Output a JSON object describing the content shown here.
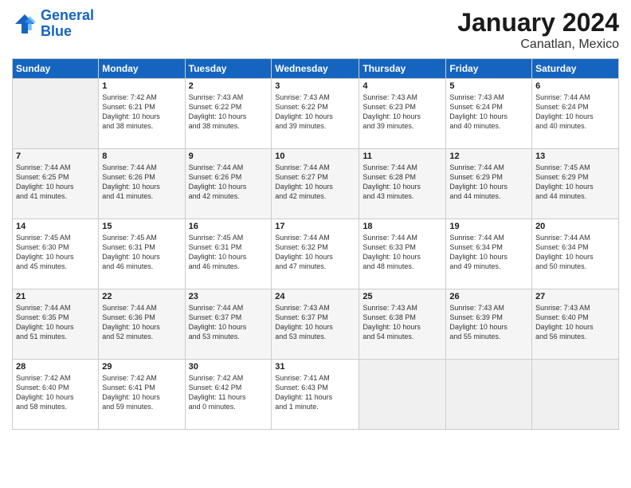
{
  "header": {
    "logo_line1": "General",
    "logo_line2": "Blue",
    "title": "January 2024",
    "subtitle": "Canatlan, Mexico"
  },
  "days_of_week": [
    "Sunday",
    "Monday",
    "Tuesday",
    "Wednesday",
    "Thursday",
    "Friday",
    "Saturday"
  ],
  "weeks": [
    [
      {
        "day": "",
        "info": ""
      },
      {
        "day": "1",
        "info": "Sunrise: 7:42 AM\nSunset: 6:21 PM\nDaylight: 10 hours\nand 38 minutes."
      },
      {
        "day": "2",
        "info": "Sunrise: 7:43 AM\nSunset: 6:22 PM\nDaylight: 10 hours\nand 38 minutes."
      },
      {
        "day": "3",
        "info": "Sunrise: 7:43 AM\nSunset: 6:22 PM\nDaylight: 10 hours\nand 39 minutes."
      },
      {
        "day": "4",
        "info": "Sunrise: 7:43 AM\nSunset: 6:23 PM\nDaylight: 10 hours\nand 39 minutes."
      },
      {
        "day": "5",
        "info": "Sunrise: 7:43 AM\nSunset: 6:24 PM\nDaylight: 10 hours\nand 40 minutes."
      },
      {
        "day": "6",
        "info": "Sunrise: 7:44 AM\nSunset: 6:24 PM\nDaylight: 10 hours\nand 40 minutes."
      }
    ],
    [
      {
        "day": "7",
        "info": "Sunrise: 7:44 AM\nSunset: 6:25 PM\nDaylight: 10 hours\nand 41 minutes."
      },
      {
        "day": "8",
        "info": "Sunrise: 7:44 AM\nSunset: 6:26 PM\nDaylight: 10 hours\nand 41 minutes."
      },
      {
        "day": "9",
        "info": "Sunrise: 7:44 AM\nSunset: 6:26 PM\nDaylight: 10 hours\nand 42 minutes."
      },
      {
        "day": "10",
        "info": "Sunrise: 7:44 AM\nSunset: 6:27 PM\nDaylight: 10 hours\nand 42 minutes."
      },
      {
        "day": "11",
        "info": "Sunrise: 7:44 AM\nSunset: 6:28 PM\nDaylight: 10 hours\nand 43 minutes."
      },
      {
        "day": "12",
        "info": "Sunrise: 7:44 AM\nSunset: 6:29 PM\nDaylight: 10 hours\nand 44 minutes."
      },
      {
        "day": "13",
        "info": "Sunrise: 7:45 AM\nSunset: 6:29 PM\nDaylight: 10 hours\nand 44 minutes."
      }
    ],
    [
      {
        "day": "14",
        "info": "Sunrise: 7:45 AM\nSunset: 6:30 PM\nDaylight: 10 hours\nand 45 minutes."
      },
      {
        "day": "15",
        "info": "Sunrise: 7:45 AM\nSunset: 6:31 PM\nDaylight: 10 hours\nand 46 minutes."
      },
      {
        "day": "16",
        "info": "Sunrise: 7:45 AM\nSunset: 6:31 PM\nDaylight: 10 hours\nand 46 minutes."
      },
      {
        "day": "17",
        "info": "Sunrise: 7:44 AM\nSunset: 6:32 PM\nDaylight: 10 hours\nand 47 minutes."
      },
      {
        "day": "18",
        "info": "Sunrise: 7:44 AM\nSunset: 6:33 PM\nDaylight: 10 hours\nand 48 minutes."
      },
      {
        "day": "19",
        "info": "Sunrise: 7:44 AM\nSunset: 6:34 PM\nDaylight: 10 hours\nand 49 minutes."
      },
      {
        "day": "20",
        "info": "Sunrise: 7:44 AM\nSunset: 6:34 PM\nDaylight: 10 hours\nand 50 minutes."
      }
    ],
    [
      {
        "day": "21",
        "info": "Sunrise: 7:44 AM\nSunset: 6:35 PM\nDaylight: 10 hours\nand 51 minutes."
      },
      {
        "day": "22",
        "info": "Sunrise: 7:44 AM\nSunset: 6:36 PM\nDaylight: 10 hours\nand 52 minutes."
      },
      {
        "day": "23",
        "info": "Sunrise: 7:44 AM\nSunset: 6:37 PM\nDaylight: 10 hours\nand 53 minutes."
      },
      {
        "day": "24",
        "info": "Sunrise: 7:43 AM\nSunset: 6:37 PM\nDaylight: 10 hours\nand 53 minutes."
      },
      {
        "day": "25",
        "info": "Sunrise: 7:43 AM\nSunset: 6:38 PM\nDaylight: 10 hours\nand 54 minutes."
      },
      {
        "day": "26",
        "info": "Sunrise: 7:43 AM\nSunset: 6:39 PM\nDaylight: 10 hours\nand 55 minutes."
      },
      {
        "day": "27",
        "info": "Sunrise: 7:43 AM\nSunset: 6:40 PM\nDaylight: 10 hours\nand 56 minutes."
      }
    ],
    [
      {
        "day": "28",
        "info": "Sunrise: 7:42 AM\nSunset: 6:40 PM\nDaylight: 10 hours\nand 58 minutes."
      },
      {
        "day": "29",
        "info": "Sunrise: 7:42 AM\nSunset: 6:41 PM\nDaylight: 10 hours\nand 59 minutes."
      },
      {
        "day": "30",
        "info": "Sunrise: 7:42 AM\nSunset: 6:42 PM\nDaylight: 11 hours\nand 0 minutes."
      },
      {
        "day": "31",
        "info": "Sunrise: 7:41 AM\nSunset: 6:43 PM\nDaylight: 11 hours\nand 1 minute."
      },
      {
        "day": "",
        "info": ""
      },
      {
        "day": "",
        "info": ""
      },
      {
        "day": "",
        "info": ""
      }
    ]
  ]
}
